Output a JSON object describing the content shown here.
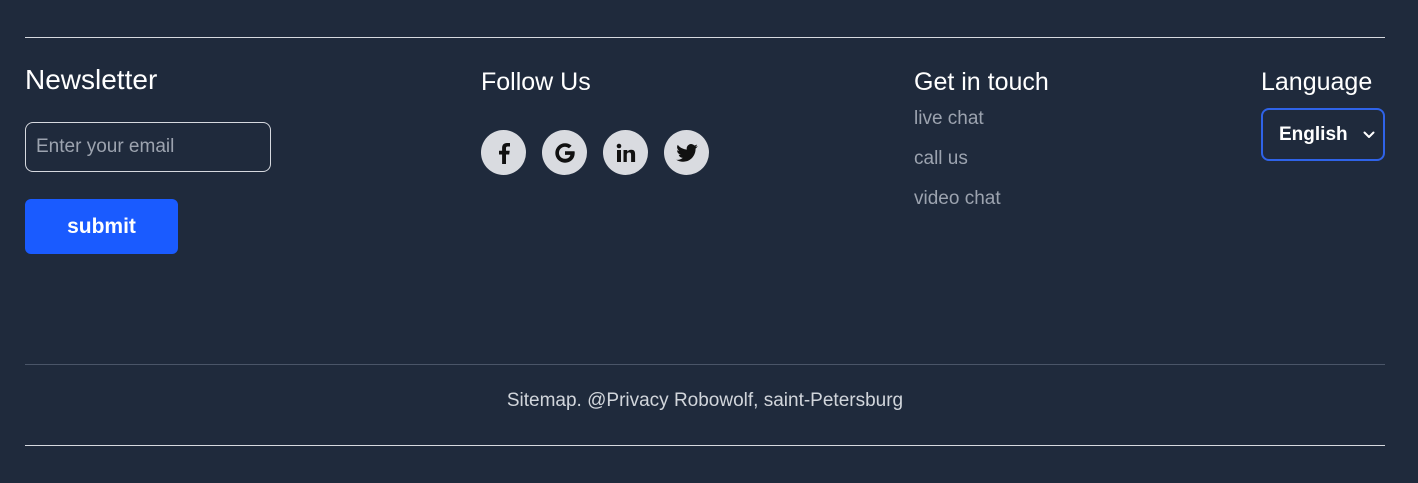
{
  "newsletter": {
    "title": "Newsletter",
    "email_placeholder": "Enter your email",
    "submit_label": "submit"
  },
  "follow": {
    "title": "Follow Us",
    "icons": [
      "facebook-icon",
      "google-icon",
      "linkedin-icon",
      "twitter-icon"
    ]
  },
  "contact": {
    "title": "Get in touch",
    "links": [
      {
        "label": "live chat"
      },
      {
        "label": "call us"
      },
      {
        "label": "video chat"
      }
    ]
  },
  "language": {
    "title": "Language",
    "selected": "English"
  },
  "footer": {
    "copyright": "Sitemap. @Privacy Robowolf, saint-Petersburg"
  },
  "colors": {
    "background": "#1f2a3c",
    "accent": "#1a5bff",
    "muted_text": "#9ca3af",
    "icon_bg": "#d9dbe0"
  }
}
